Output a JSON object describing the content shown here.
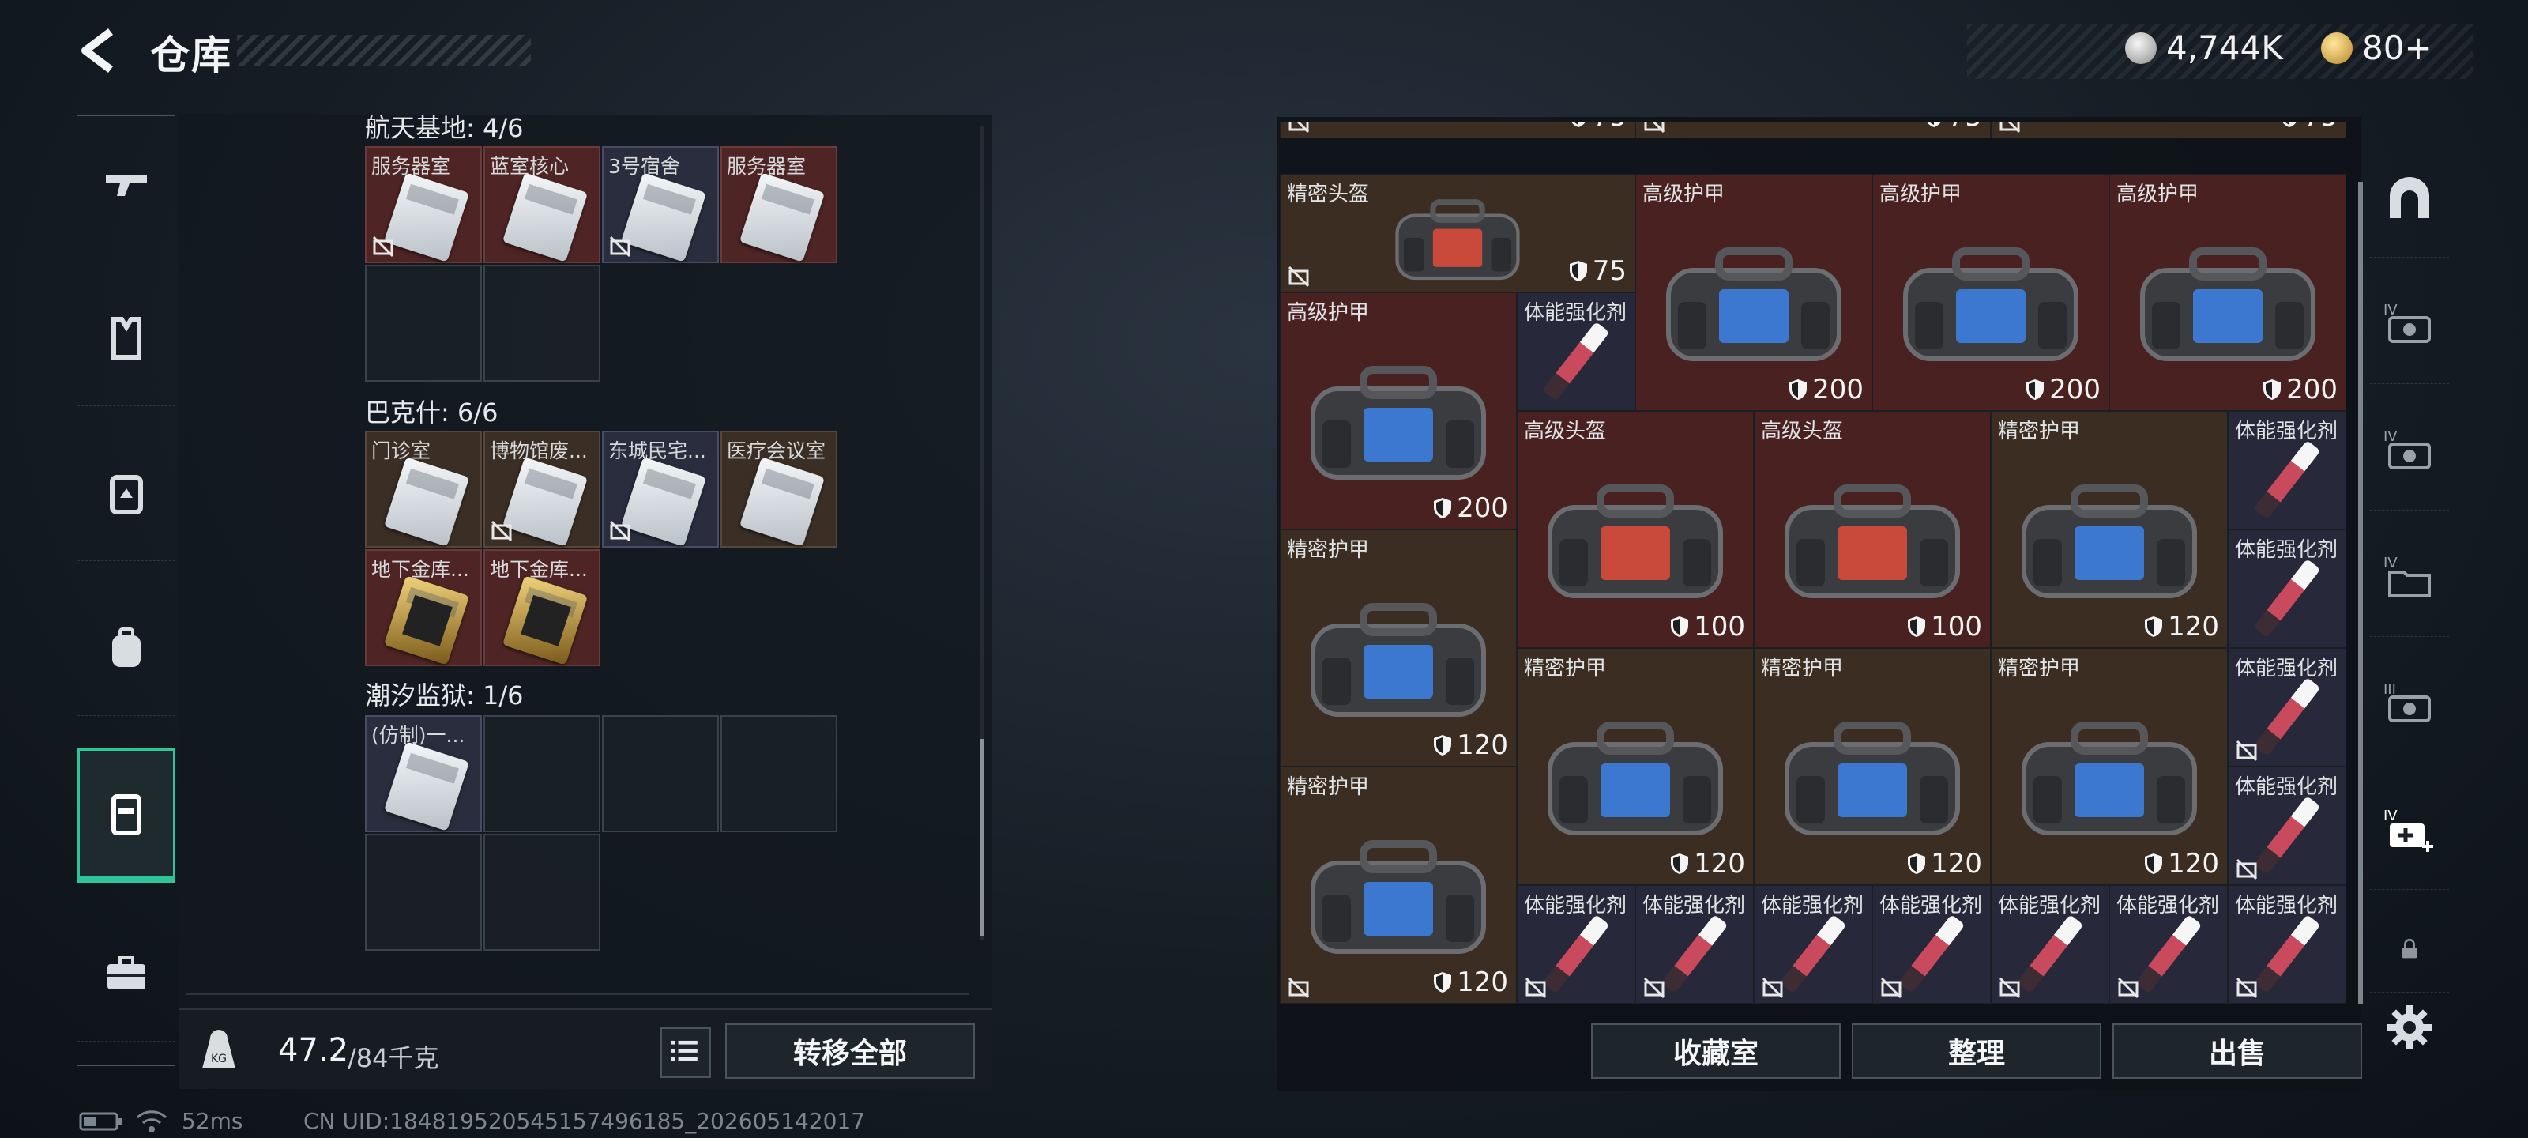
{
  "header": {
    "title": "仓库"
  },
  "currency": {
    "silver": "4,744K",
    "gold": "80+"
  },
  "sections": [
    {
      "label": "航天基地: 4/6",
      "rows": [
        [
          {
            "name": "服务器室",
            "color": "red",
            "card": "white",
            "nosale": true
          },
          {
            "name": "蓝室核心",
            "color": "red",
            "card": "white",
            "nosale": false
          },
          {
            "name": "3号宿舍",
            "color": "blue",
            "card": "white",
            "nosale": true
          },
          {
            "name": "服务器室",
            "color": "red",
            "card": "white",
            "nosale": false
          }
        ]
      ]
    },
    {
      "label": "巴克什: 6/6",
      "rows": [
        [
          {
            "name": "门诊室",
            "color": "brown",
            "card": "white",
            "nosale": false
          },
          {
            "name": "博物馆废...",
            "color": "brown",
            "card": "white",
            "nosale": true
          },
          {
            "name": "东城民宅...",
            "color": "blue",
            "card": "white",
            "nosale": true
          },
          {
            "name": "医疗会议室",
            "color": "brown",
            "card": "white",
            "nosale": false
          }
        ],
        [
          {
            "name": "地下金库...",
            "color": "red",
            "card": "gold",
            "nosale": false
          },
          {
            "name": "地下金库...",
            "color": "red",
            "card": "gold",
            "nosale": false
          }
        ]
      ]
    },
    {
      "label": "潮汐监狱: 1/6",
      "rows": [
        [
          {
            "name": "(仿制)一...",
            "color": "blue",
            "card": "white",
            "nosale": false
          }
        ]
      ]
    }
  ],
  "footer_left": {
    "weight_current": "47.2",
    "weight_max": "/84千克",
    "transfer_all": "转移全部"
  },
  "inventory": {
    "top_row": [
      "75",
      "75",
      "75"
    ],
    "items": [
      {
        "name": "精密头盔",
        "dur": "75",
        "type": "bag",
        "accent": "red"
      },
      {
        "name": "高级护甲",
        "dur": "200",
        "type": "bag",
        "accent": "blue"
      },
      {
        "name": "高级护甲",
        "dur": "200",
        "type": "bag",
        "accent": "blue"
      },
      {
        "name": "高级护甲",
        "dur": "200",
        "type": "bag",
        "accent": "blue"
      },
      {
        "name": "高级护甲",
        "dur": "200",
        "type": "bag",
        "accent": "blue"
      },
      {
        "name": "体能强化剂",
        "type": "syringe"
      },
      {
        "name": "高级头盔",
        "dur": "100",
        "type": "bag",
        "accent": "red"
      },
      {
        "name": "高级头盔",
        "dur": "100",
        "type": "bag",
        "accent": "red"
      },
      {
        "name": "精密护甲",
        "dur": "120",
        "type": "bag",
        "accent": "blue"
      },
      {
        "name": "体能强化剂",
        "type": "syringe"
      },
      {
        "name": "精密护甲",
        "dur": "120",
        "type": "bag",
        "accent": "blue"
      },
      {
        "name": "体能强化剂",
        "type": "syringe"
      },
      {
        "name": "精密护甲",
        "dur": "120",
        "type": "bag",
        "accent": "blue"
      },
      {
        "name": "精密护甲",
        "dur": "120",
        "type": "bag",
        "accent": "blue"
      },
      {
        "name": "精密护甲",
        "dur": "120",
        "type": "bag",
        "accent": "blue"
      },
      {
        "name": "体能强化剂",
        "type": "syringe"
      },
      {
        "name": "精密护甲",
        "dur": "120",
        "type": "bag",
        "accent": "blue"
      },
      {
        "name": "体能强化剂",
        "type": "syringe"
      },
      {
        "name": "体能强化剂",
        "type": "syringe"
      },
      {
        "name": "体能强化剂",
        "type": "syringe"
      },
      {
        "name": "体能强化剂",
        "type": "syringe"
      },
      {
        "name": "体能强化剂",
        "type": "syringe"
      },
      {
        "name": "体能强化剂",
        "type": "syringe"
      },
      {
        "name": "体能强化剂",
        "type": "syringe"
      }
    ]
  },
  "footer_right": {
    "collection": "收藏室",
    "organize": "整理",
    "sell": "出售"
  },
  "status": {
    "ping": "52ms",
    "uid": "CN UID:18481952054515749618​5_202605142017"
  },
  "icons": {
    "sidebar": [
      "gun-icon",
      "vest-icon",
      "backpack-rig-icon",
      "backpack-icon",
      "container-icon",
      "toolbox-icon"
    ],
    "rail": [
      "arch-icon",
      "iv-camera-icon",
      "iv-camera-icon",
      "iv-folder-icon",
      "iii-camera-icon",
      "iv-medkit-icon",
      "lock-icon"
    ]
  }
}
